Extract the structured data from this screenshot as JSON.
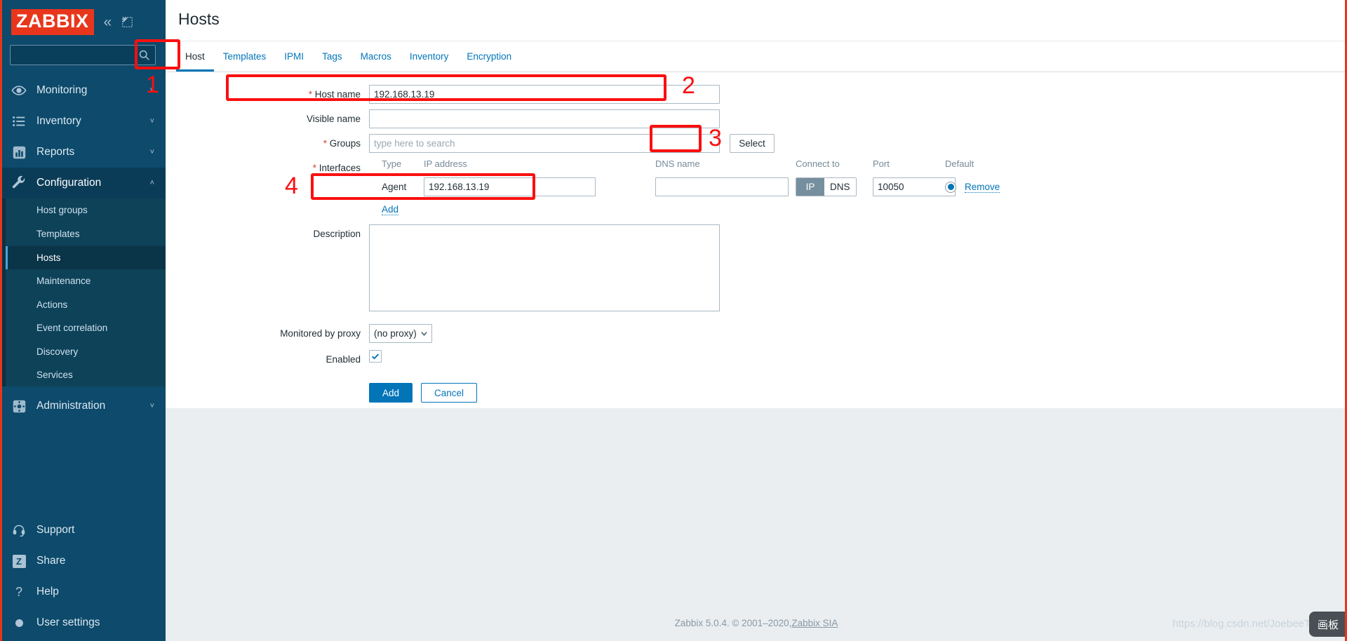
{
  "brand": {
    "logo_text": "ZABBIX",
    "accent_red": "#e8361c",
    "accent_blue": "#0275b8",
    "sidebar_bg": "#0d4a6b"
  },
  "sidebar": {
    "collapse_icon": "collapse-icon",
    "expand_icon": "expand-icon",
    "search": {
      "value": "",
      "placeholder": ""
    },
    "items": [
      {
        "label": "Monitoring",
        "icon": "eye-icon",
        "chevron": "chevron-down"
      },
      {
        "label": "Inventory",
        "icon": "list-icon",
        "chevron": "chevron-down"
      },
      {
        "label": "Reports",
        "icon": "bar-chart-icon",
        "chevron": "chevron-down"
      },
      {
        "label": "Configuration",
        "icon": "wrench-icon",
        "chevron": "chevron-up"
      }
    ],
    "configuration_submenu": [
      {
        "label": "Host groups",
        "active": false
      },
      {
        "label": "Templates",
        "active": false
      },
      {
        "label": "Hosts",
        "active": true
      },
      {
        "label": "Maintenance",
        "active": false
      },
      {
        "label": "Actions",
        "active": false
      },
      {
        "label": "Event correlation",
        "active": false
      },
      {
        "label": "Discovery",
        "active": false
      },
      {
        "label": "Services",
        "active": false
      }
    ],
    "administration": {
      "label": "Administration",
      "icon": "gear-icon",
      "chevron": "chevron-down"
    },
    "bottom_items": [
      {
        "label": "Support",
        "icon": "headset-icon"
      },
      {
        "label": "Share",
        "icon": "z-badge-icon"
      },
      {
        "label": "Help",
        "icon": "question-icon"
      },
      {
        "label": "User settings",
        "icon": "user-dot-icon"
      }
    ]
  },
  "header": {
    "title": "Hosts"
  },
  "tabs": [
    {
      "label": "Host",
      "active": true
    },
    {
      "label": "Templates",
      "active": false
    },
    {
      "label": "IPMI",
      "active": false
    },
    {
      "label": "Tags",
      "active": false
    },
    {
      "label": "Macros",
      "active": false
    },
    {
      "label": "Inventory",
      "active": false
    },
    {
      "label": "Encryption",
      "active": false
    }
  ],
  "form": {
    "host_name": {
      "label": "Host name",
      "required": true,
      "value": "192.168.13.19",
      "placeholder": ""
    },
    "visible_name": {
      "label": "Visible name",
      "required": false,
      "value": "",
      "placeholder": ""
    },
    "groups": {
      "label": "Groups",
      "required": true,
      "value": "",
      "placeholder": "type here to search",
      "select_button": "Select"
    },
    "interfaces": {
      "label": "Interfaces",
      "required": true,
      "columns": [
        "Type",
        "IP address",
        "DNS name",
        "Connect to",
        "Port",
        "Default"
      ],
      "rows": [
        {
          "type": "Agent",
          "ip": "192.168.13.19",
          "dns": "",
          "connect_to": {
            "options": [
              "IP",
              "DNS"
            ],
            "selected": "IP"
          },
          "port": "10050",
          "default_selected": true,
          "remove_label": "Remove"
        }
      ],
      "add_label": "Add"
    },
    "description": {
      "label": "Description",
      "value": "",
      "placeholder": ""
    },
    "monitored_by_proxy": {
      "label": "Monitored by proxy",
      "selected": "(no proxy)",
      "options": [
        "(no proxy)"
      ]
    },
    "enabled": {
      "label": "Enabled",
      "checked": true
    },
    "submit_label": "Add",
    "cancel_label": "Cancel"
  },
  "annotations": [
    {
      "number": "1"
    },
    {
      "number": "2"
    },
    {
      "number": "3"
    },
    {
      "number": "4"
    }
  ],
  "footer": {
    "text": "Zabbix 5.0.4. © 2001–2020, ",
    "link": "Zabbix SIA"
  },
  "watermark": {
    "text": "https://blog.csdn.net/JoebeeT",
    "badge": "画板"
  }
}
